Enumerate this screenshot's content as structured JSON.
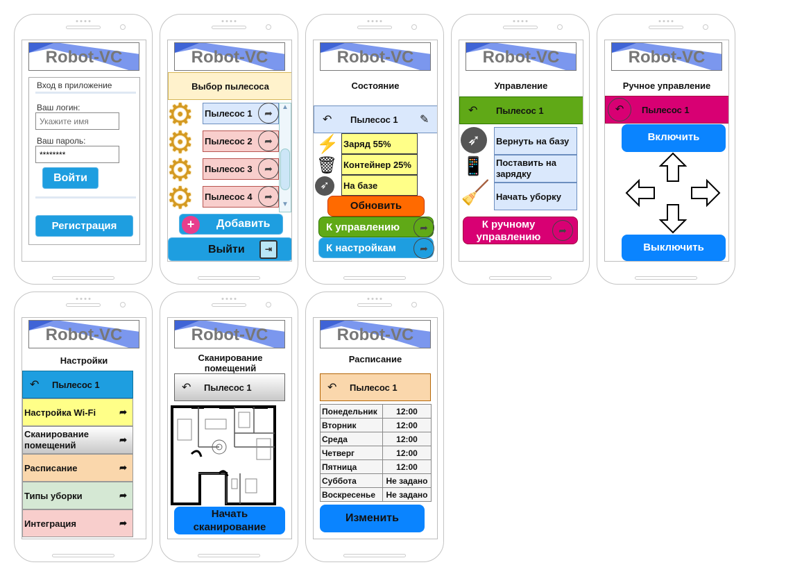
{
  "logo": "Robot-VC",
  "login": {
    "header": "Вход в приложение",
    "login_label": "Ваш логин:",
    "login_placeholder": "Укажите имя",
    "password_label": "Ваш пароль:",
    "password_value": "********",
    "submit": "Войти",
    "register": "Регистрация"
  },
  "select": {
    "header": "Выбор пылесоса",
    "items": [
      "Пылесос 1",
      "Пылесос 2",
      "Пылесос 3",
      "Пылесос 4"
    ],
    "add": "Добавить",
    "logout": "Выйти"
  },
  "status": {
    "title": "Состояние",
    "device": "Пылесос 1",
    "charge": "Заряд 55%",
    "container": "Контейнер 25%",
    "state": "На базе",
    "refresh": "Обновить",
    "to_control": "К управлению",
    "to_settings": "К настройкам"
  },
  "control": {
    "title": "Управление",
    "device": "Пылесос 1",
    "return_base": "Вернуть на базу",
    "charge": "Поставить на зарядку",
    "start_clean": "Начать уборку",
    "manual": "К ручному управлению"
  },
  "manual": {
    "title": "Ручное управление",
    "device": "Пылесос 1",
    "on": "Включить",
    "off": "Выключить"
  },
  "settings": {
    "title": "Настройки",
    "device": "Пылесос 1",
    "items": [
      "Настройка Wi-Fi",
      "Сканирование помещений",
      "Расписание",
      "Типы уборки",
      "Интеграция"
    ]
  },
  "scan": {
    "title": "Сканирование помещений",
    "device": "Пылесос 1",
    "start": "Начать сканирование"
  },
  "schedule": {
    "title": "Расписание",
    "device": "Пылесос 1",
    "rows": [
      [
        "Понедельник",
        "12:00"
      ],
      [
        "Вторник",
        "12:00"
      ],
      [
        "Среда",
        "12:00"
      ],
      [
        "Четверг",
        "12:00"
      ],
      [
        "Пятница",
        "12:00"
      ],
      [
        "Суббота",
        "Не задано"
      ],
      [
        "Воскресенье",
        "Не задано"
      ]
    ],
    "edit": "Изменить"
  },
  "colors": {
    "blue": "#1e9ee0",
    "orange": "#ff6a00",
    "green": "#60a917",
    "magenta": "#d80073",
    "bright_blue": "#0a84ff"
  }
}
